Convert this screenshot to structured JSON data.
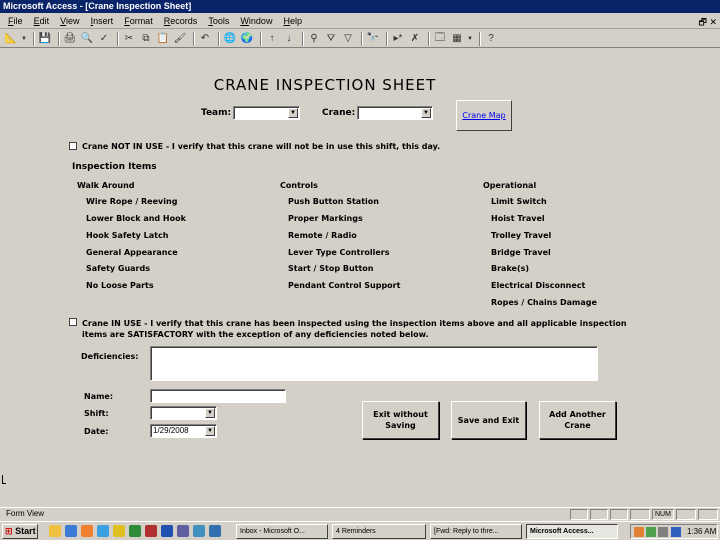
{
  "window": {
    "title": "Microsoft Access - [Crane Inspection Sheet]"
  },
  "menu": [
    "File",
    "Edit",
    "View",
    "Insert",
    "Format",
    "Records",
    "Tools",
    "Window",
    "Help"
  ],
  "form": {
    "title": "CRANE INSPECTION SHEET",
    "team_label": "Team:",
    "crane_label": "Crane:",
    "team_value": "",
    "crane_value": "",
    "crane_map_link": "Crane Map",
    "not_in_use_text": "Crane NOT IN USE - I verify that this crane will not be in use this shift, this day.",
    "inspection_items_label": "Inspection Items",
    "walk_around": {
      "heading": "Walk Around",
      "items": [
        "Wire Rope / Reeving",
        "Lower Block and Hook",
        "Hook Safety Latch",
        "General Appearance",
        "Safety Guards",
        "No Loose Parts"
      ]
    },
    "controls": {
      "heading": "Controls",
      "items": [
        "Push Button Station",
        "Proper Markings",
        "Remote / Radio",
        "Lever Type Controllers",
        "Start / Stop Button",
        "Pendant Control Support"
      ]
    },
    "operational": {
      "heading": "Operational",
      "items": [
        "Limit Switch",
        "Hoist Travel",
        "Trolley Travel",
        "Bridge Travel",
        "Brake(s)",
        "Electrical Disconnect",
        "Ropes / Chains Damage"
      ]
    },
    "in_use_line1": "Crane IN USE - I verify that this crane has been inspected using the inspection items above and all applicable inspection",
    "in_use_line2": "items are SATISFACTORY with the exception of any deficiencies noted below.",
    "deficiencies_label": "Deficiencies:",
    "name_label": "Name:",
    "shift_label": "Shift:",
    "date_label": "Date:",
    "name_value": "",
    "shift_value": "",
    "date_value": "1/29/2008",
    "buttons": {
      "exit_without_saving": "Exit without Saving",
      "save_and_exit": "Save and Exit",
      "add_another": "Add Another Crane"
    }
  },
  "statusbar": {
    "text": "Form View",
    "num": "NUM"
  },
  "taskbar": {
    "start": "Start",
    "tasks": [
      "Inbox - Microsoft O...",
      "4 Reminders",
      "[Fwd: Reply to thre...",
      "Microsoft Access..."
    ],
    "clock": "1:36 AM"
  }
}
